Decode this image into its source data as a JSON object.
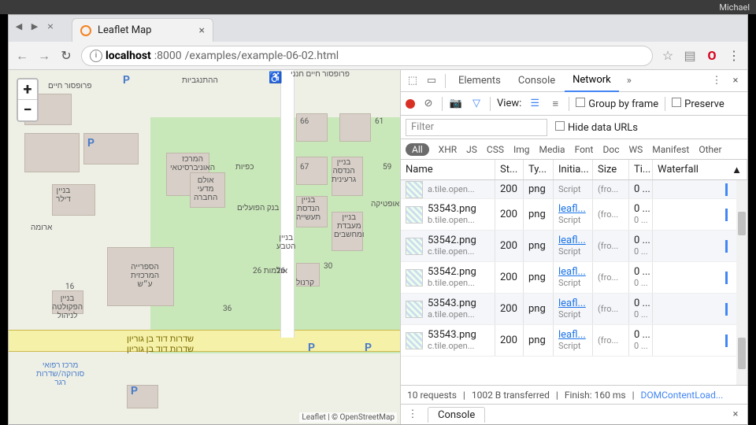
{
  "os": {
    "user": "Michael"
  },
  "browser": {
    "tab_title": "Leaflet Map",
    "url_host": "localhost",
    "url_port": ":8000",
    "url_path": "/examples/example-06-02.html"
  },
  "map": {
    "zoom_in": "+",
    "zoom_out": "−",
    "attribution": "Leaflet | © OpenStreetMap",
    "labels": {
      "prof_haim": "פרופסור חיים",
      "prof_top": "פרופסור חיים חנני",
      "hanegbiyot": "ההתנגביות",
      "dilar": "בניין\nדילר",
      "aroma": "ארומה",
      "merkaz": "המרכז\nהאוניברסיטאי",
      "kafiyot": "כפיות",
      "ulam_madaey": "אולם\nמדעי\nהחברה",
      "bank": "בנק הפועלים",
      "handasa": "בניין\nהנדסה\nגרעינית",
      "optika": "אופטיקה",
      "handasat": "בניין\nהנדסת\nתעשייה",
      "maabada": "בניין\nמעבדת\nומחשבים",
      "hasifria": "הספרייה\nהמרכזית\nע״ש",
      "ulmot": "אולמות 26",
      "hateva": "בניין\nהטבע",
      "hafakulta": "בניין\nהפקולטה\nלניהול",
      "kronol": "קרנול",
      "sdarot": "שדרות דוד בן גוריון",
      "sdarot2": "שדרות דוד בן גוריון",
      "merkaz_refui": "מרכז רפואי\nסורוקה/שדרות\nרגר",
      "n66": "66",
      "n67": "67",
      "n61": "61",
      "n59": "59",
      "n30": "30",
      "n26": "26",
      "n16": "16",
      "n36": "36"
    }
  },
  "devtools": {
    "tabs": {
      "elements": "Elements",
      "console": "Console",
      "network": "Network"
    },
    "view_label": "View:",
    "group_by_frame": "Group by frame",
    "preserve": "Preserve",
    "filter_placeholder": "Filter",
    "hide_data_urls": "Hide data URLs",
    "type_filters": [
      "All",
      "XHR",
      "JS",
      "CSS",
      "Img",
      "Media",
      "Font",
      "Doc",
      "WS",
      "Manifest",
      "Other"
    ],
    "columns": {
      "name": "Name",
      "status": "St...",
      "type": "Ty...",
      "initiator": "Initia...",
      "size": "Size",
      "time": "Ti...",
      "waterfall": "Waterfall"
    },
    "rows": [
      {
        "name": "",
        "host": "a.tile.open...",
        "status": "200",
        "type": "png",
        "initiator": "",
        "initiator_sub": "Script",
        "size": "(fro...",
        "time": "0 ..."
      },
      {
        "name": "53543.png",
        "host": "b.tile.open...",
        "status": "200",
        "type": "png",
        "initiator": "leafl...",
        "initiator_sub": "Script",
        "size": "(fro...",
        "time": "0 ...",
        "time2": "0 ..."
      },
      {
        "name": "53542.png",
        "host": "c.tile.open...",
        "status": "200",
        "type": "png",
        "initiator": "leafl...",
        "initiator_sub": "Script",
        "size": "(fro...",
        "time": "0 ...",
        "time2": "0 ..."
      },
      {
        "name": "53542.png",
        "host": "b.tile.open...",
        "status": "200",
        "type": "png",
        "initiator": "leafl...",
        "initiator_sub": "Script",
        "size": "(fro...",
        "time": "0 ...",
        "time2": "0 ..."
      },
      {
        "name": "53543.png",
        "host": "a.tile.open...",
        "status": "200",
        "type": "png",
        "initiator": "leafl...",
        "initiator_sub": "Script",
        "size": "(fro...",
        "time": "0 ...",
        "time2": "0 ..."
      },
      {
        "name": "53543.png",
        "host": "c.tile.open...",
        "status": "200",
        "type": "png",
        "initiator": "leafl...",
        "initiator_sub": "Script",
        "size": "(fro...",
        "time": "0 ...",
        "time2": "0 ..."
      }
    ],
    "status": {
      "requests": "10 requests",
      "transferred": "1002 B transferred",
      "finish": "Finish: 160 ms",
      "dcl": "DOMContentLoad..."
    },
    "drawer_tab": "Console"
  }
}
